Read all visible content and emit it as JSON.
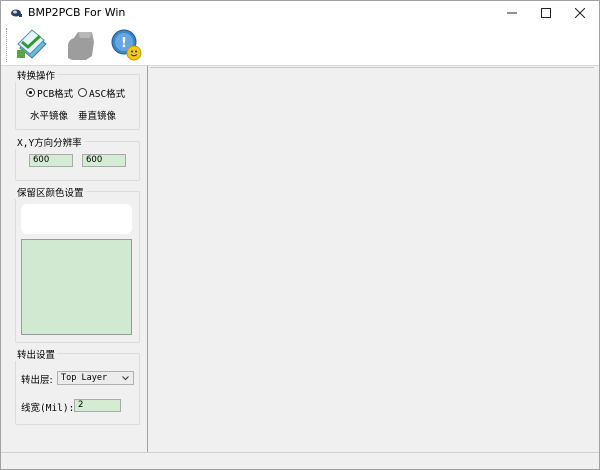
{
  "window": {
    "title": "BMP2PCB For Win",
    "controls": [
      "minimize-icon",
      "maximize-icon",
      "close-icon"
    ]
  },
  "toolbar": {
    "buttons": [
      {
        "name": "convert-icon"
      },
      {
        "name": "export-icon"
      },
      {
        "name": "about-icon"
      }
    ]
  },
  "convert": {
    "title": "转换操作",
    "pcb_label": "PCB格式",
    "asc_label": "ASC格式",
    "selected": "pcb",
    "mirror_h": "水平镜像",
    "mirror_v": "垂直镜像"
  },
  "resolution": {
    "title": "X,Y方向分辨率",
    "x": "600",
    "y": "600"
  },
  "reserve": {
    "title": "保留区颜色设置",
    "color": "#d1e9d1"
  },
  "output": {
    "title": "转出设置",
    "layer_label": "转出层:",
    "layer_value": "Top  Layer",
    "width_label": "线宽(Mil):",
    "width_value": "2"
  },
  "colors": {
    "field_bg": "#d4ebd4",
    "window_bg": "#f0f0f0"
  }
}
